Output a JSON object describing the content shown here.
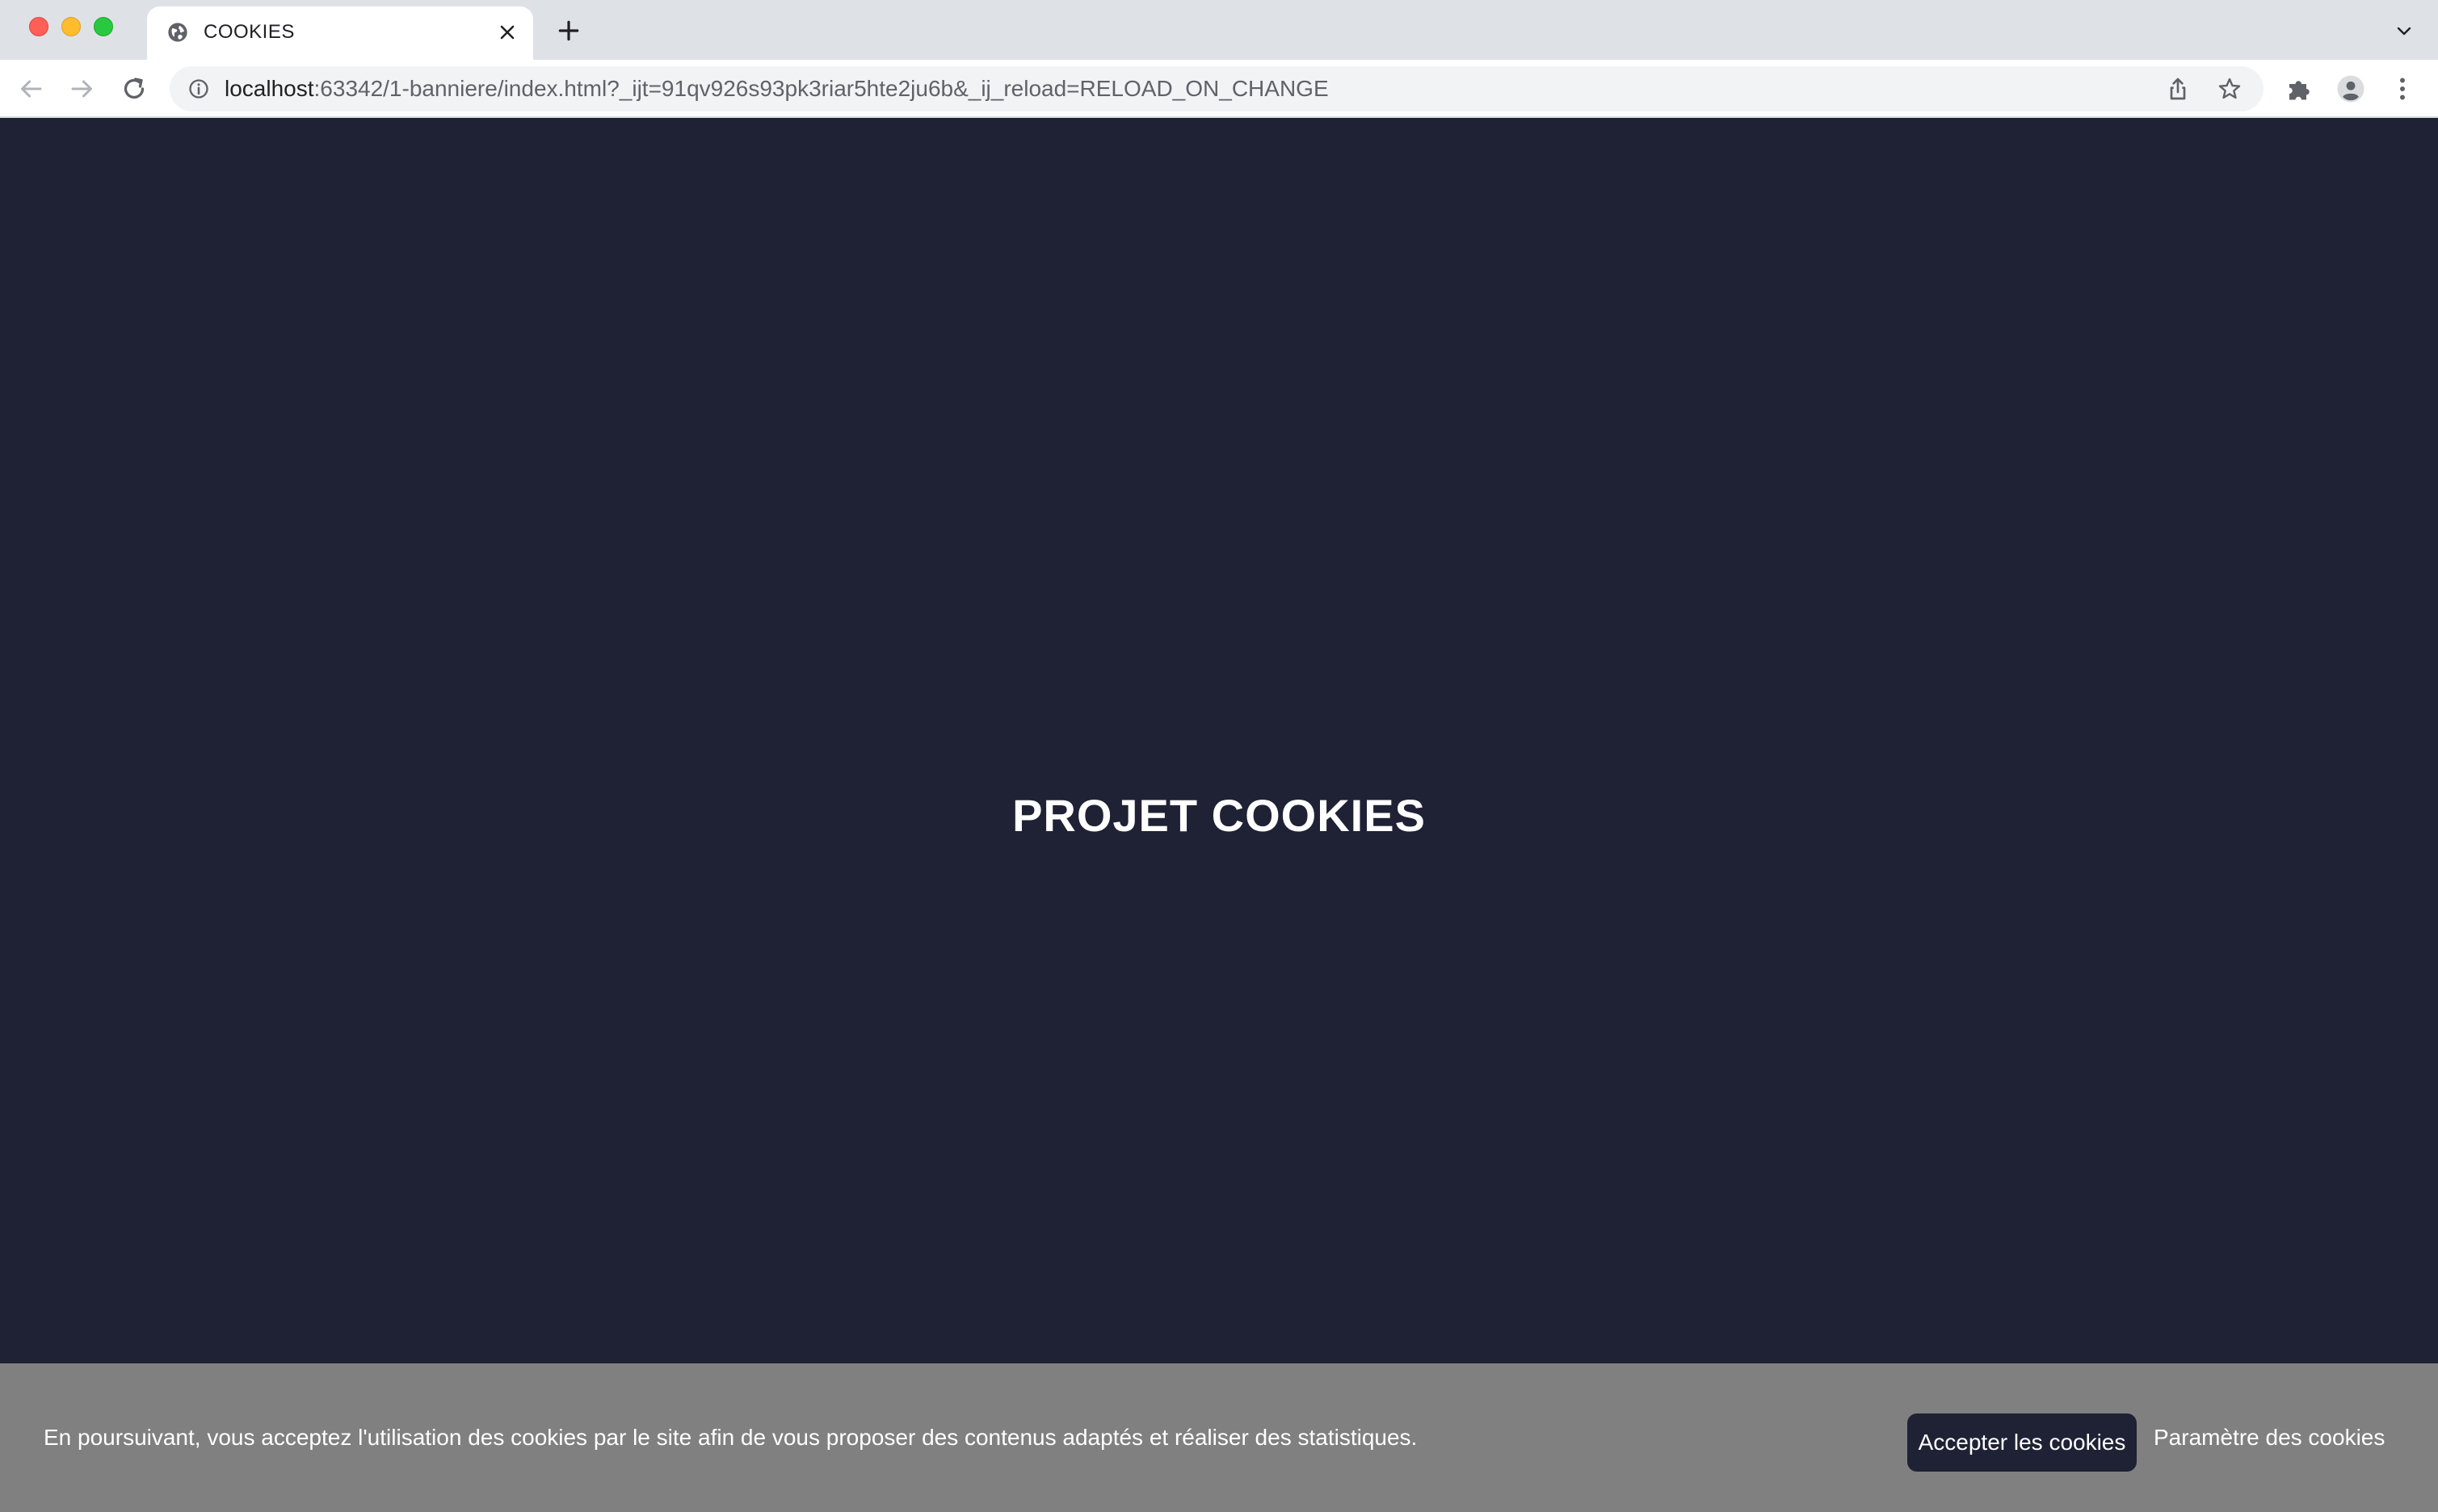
{
  "browser": {
    "tab": {
      "title": "COOKIES",
      "favicon": "globe-icon",
      "close_icon": "close-icon"
    },
    "new_tab_icon": "plus-icon",
    "tab_menu_icon": "chevron-down-icon",
    "toolbar": {
      "back_icon": "arrow-left-icon",
      "forward_icon": "arrow-right-icon",
      "reload_icon": "reload-icon",
      "extensions_icon": "puzzle-icon",
      "profile_icon": "avatar-icon",
      "menu_icon": "kebab-menu-icon"
    },
    "omnibox": {
      "info_icon": "info-icon",
      "url_host": "localhost",
      "url_rest": ":63342/1-banniere/index.html?_ijt=91qv926s93pk3riar5hte2ju6b&_ij_reload=RELOAD_ON_CHANGE",
      "share_icon": "share-icon",
      "bookmark_icon": "star-icon"
    }
  },
  "page": {
    "title": "PROJET COOKIES",
    "background_color": "#1f2235"
  },
  "cookie_banner": {
    "text": "En poursuivant, vous acceptez l'utilisation des cookies par le site afin de vous proposer des contenus adaptés et réaliser des statistiques.",
    "accept_label": "Accepter les cookies",
    "settings_label": "Paramètre des cookies",
    "background_color": "#808080"
  }
}
